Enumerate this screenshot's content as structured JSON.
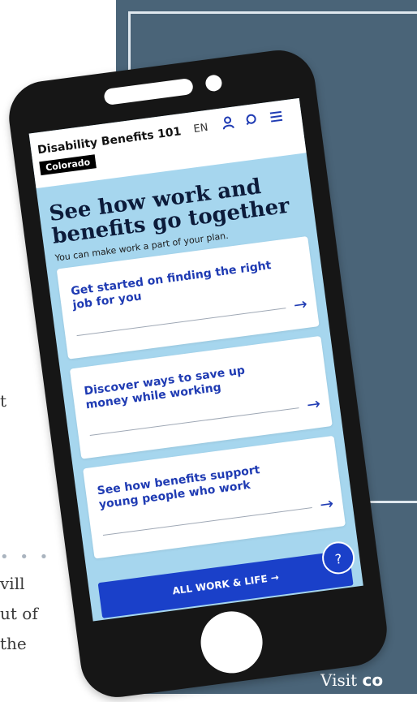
{
  "app": {
    "title": "Disability Benefits 101",
    "state": "Colorado",
    "language": "EN"
  },
  "header_icons": [
    "user-icon",
    "search-icon",
    "menu-icon"
  ],
  "hero": {
    "title": "See how work and benefits go together",
    "subtitle": "You can make work a part of your plan."
  },
  "cards": [
    {
      "label": "Get started on finding the right job for you"
    },
    {
      "label": "Discover ways to save up money while working"
    },
    {
      "label": "See how benefits support young people who work"
    }
  ],
  "cta_label": "ALL WORK & LIFE →",
  "help_label": "?",
  "background_text": {
    "left_line1": "t",
    "left_line2": "vill",
    "left_line3": "ut of",
    "left_line4": "the",
    "visit_prefix": "Visit ",
    "visit_bold": "co"
  },
  "colors": {
    "panel": "#4a6478",
    "screen_bg": "#a6d6ee",
    "link_blue": "#1f3bb3",
    "cta_blue": "#1a40c9"
  }
}
